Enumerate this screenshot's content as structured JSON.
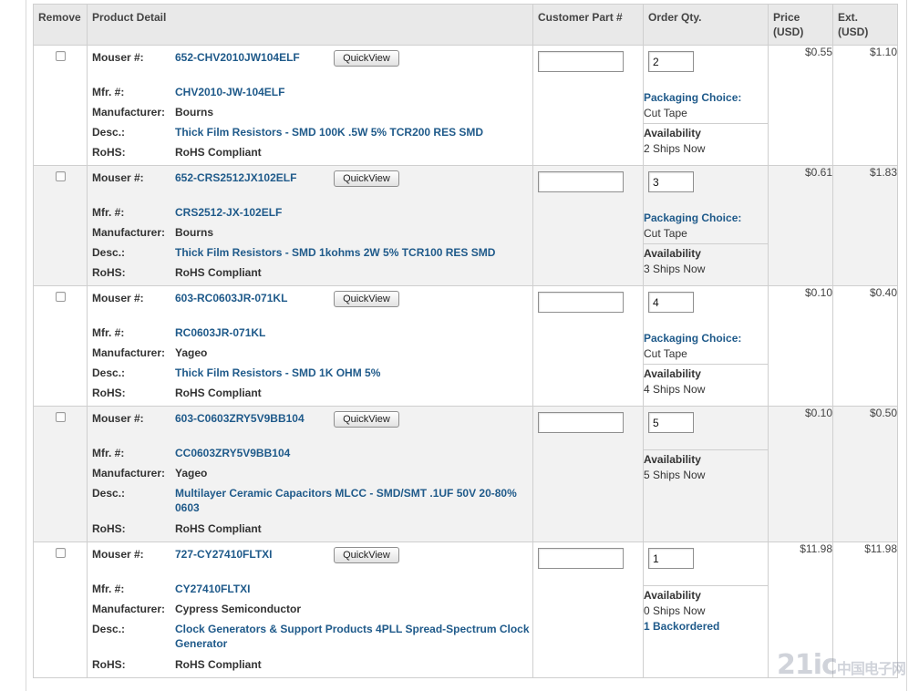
{
  "columns": {
    "remove": "Remove",
    "product_detail": "Product Detail",
    "customer_part": "Customer Part #",
    "order_qty": "Order Qty.",
    "price_line1": "Price",
    "price_line2": "(USD)",
    "ext_line1": "Ext.",
    "ext_line2": "(USD)"
  },
  "labels": {
    "mouser": "Mouser #:",
    "mfr": "Mfr. #:",
    "manufacturer": "Manufacturer:",
    "desc": "Desc.:",
    "rohs": "RoHS:",
    "quickview": "QuickView",
    "packaging_choice": "Packaging Choice:",
    "availability": "Availability"
  },
  "items": [
    {
      "mouser": "652-CHV2010JW104ELF",
      "mfr": "CHV2010-JW-104ELF",
      "manufacturer": "Bourns",
      "desc": "Thick Film Resistors - SMD 100K .5W 5% TCR200 RES SMD",
      "rohs": "RoHS Compliant",
      "customer_part": "",
      "qty": "2",
      "packaging": "Cut Tape",
      "availability": "2 Ships Now",
      "price": "$0.55",
      "ext": "$1.10"
    },
    {
      "mouser": "652-CRS2512JX102ELF",
      "mfr": "CRS2512-JX-102ELF",
      "manufacturer": "Bourns",
      "desc": "Thick Film Resistors - SMD 1kohms 2W 5% TCR100 RES SMD",
      "rohs": "RoHS Compliant",
      "customer_part": "",
      "qty": "3",
      "packaging": "Cut Tape",
      "availability": "3 Ships Now",
      "price": "$0.61",
      "ext": "$1.83"
    },
    {
      "mouser": "603-RC0603JR-071KL",
      "mfr": "RC0603JR-071KL",
      "manufacturer": "Yageo",
      "desc": "Thick Film Resistors - SMD 1K OHM 5%",
      "rohs": "RoHS Compliant",
      "customer_part": "",
      "qty": "4",
      "packaging": "Cut Tape",
      "availability": "4 Ships Now",
      "price": "$0.10",
      "ext": "$0.40"
    },
    {
      "mouser": "603-C0603ZRY5V9BB104",
      "mfr": "CC0603ZRY5V9BB104",
      "manufacturer": "Yageo",
      "desc": "Multilayer Ceramic Capacitors MLCC - SMD/SMT .1UF 50V 20-80% 0603",
      "rohs": "RoHS Compliant",
      "customer_part": "",
      "qty": "5",
      "availability": "5 Ships Now",
      "price": "$0.10",
      "ext": "$0.50"
    },
    {
      "mouser": "727-CY27410FLTXI",
      "mfr": "CY27410FLTXI",
      "manufacturer": "Cypress Semiconductor",
      "desc": "Clock Generators & Support Products 4PLL Spread-Spectrum Clock Generator",
      "rohs": "RoHS Compliant",
      "customer_part": "",
      "qty": "1",
      "availability": "0 Ships Now",
      "backordered": "1 Backordered",
      "price": "$11.98",
      "ext": "$11.98"
    }
  ],
  "watermark": {
    "main": "21ic",
    "sub": "中国电子网"
  }
}
